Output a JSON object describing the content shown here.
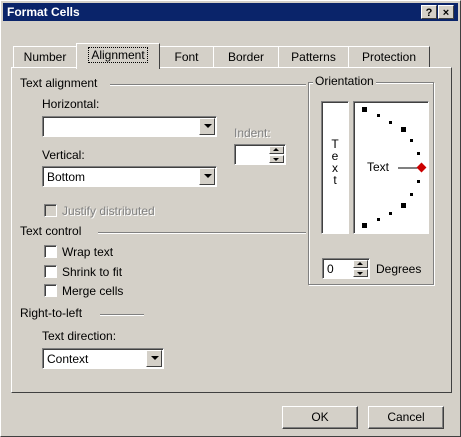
{
  "title": "Format Cells",
  "title_buttons": {
    "help": "?",
    "close": "×"
  },
  "tabs": [
    {
      "label": "Number"
    },
    {
      "label": "Alignment"
    },
    {
      "label": "Font"
    },
    {
      "label": "Border"
    },
    {
      "label": "Patterns"
    },
    {
      "label": "Protection"
    }
  ],
  "active_tab": "Alignment",
  "text_alignment": {
    "heading": "Text alignment",
    "horizontal_label": "Horizontal:",
    "horizontal_value": "",
    "vertical_label": "Vertical:",
    "vertical_value": "Bottom",
    "indent_label": "Indent:",
    "indent_value": "",
    "justify_label": "Justify distributed"
  },
  "text_control": {
    "heading": "Text control",
    "wrap_label": "Wrap text",
    "shrink_label": "Shrink to fit",
    "merge_label": "Merge cells"
  },
  "rtl": {
    "heading": "Right-to-left",
    "direction_label": "Text direction:",
    "direction_value": "Context"
  },
  "orientation": {
    "heading": "Orientation",
    "vertical_text": "Text",
    "dial_text": "Text",
    "degrees_value": "0",
    "degrees_label": "Degrees"
  },
  "buttons": {
    "ok": "OK",
    "cancel": "Cancel"
  },
  "colors": {
    "title_bg": "#0a246a",
    "dialog_bg": "#d4d0c8",
    "dial_marker": "#cc0000"
  }
}
